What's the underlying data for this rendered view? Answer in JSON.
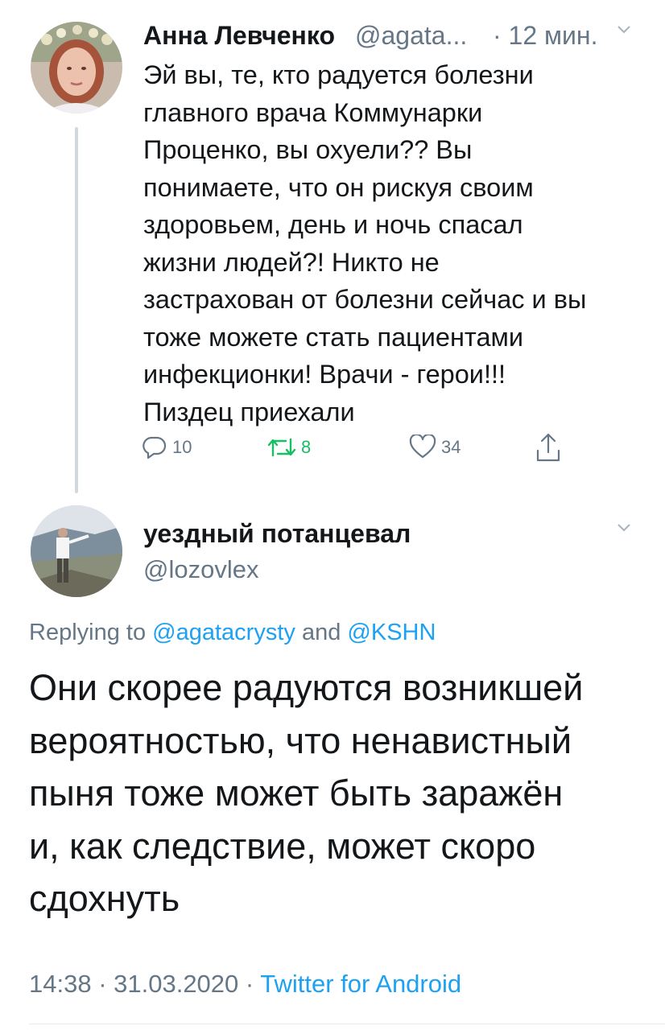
{
  "tweet1": {
    "author_name": "Анна Левченко",
    "handle": "@agata...",
    "time": "· 12 мин.",
    "body_lines": [
      "Эй вы, те, кто радуется болезни",
      "главного врача Коммунарки",
      "Проценко, вы охуели?? Вы",
      "понимаете, что он рискуя своим",
      "здоровьем, день и ночь спасал",
      "жизни людей?! Никто не",
      "застрахован от болезни сейчас и вы",
      "тоже можете стать пациентами",
      "инфекционки! Врачи - герои!!!",
      "Пиздец приехали"
    ],
    "replies": "10",
    "retweets": "8",
    "likes": "34"
  },
  "tweet2": {
    "author_name": "уездный потанцевал",
    "handle": "@lozovlex",
    "replying_prefix": "Replying to",
    "mention1": "@agatacrysty",
    "and": "and",
    "mention2": "@KSHN",
    "body_lines": [
      "Они скорее радуются возникшей",
      "вероятностью, что ненавистный",
      "пыня тоже может быть заражён",
      "и, как следствие, может скоро",
      "сдохнуть"
    ],
    "timestamp": "14:38 · 31.03.2020 ·",
    "source": "Twitter for Android"
  },
  "icons": {
    "reply": "reply-icon",
    "retweet": "retweet-icon",
    "like": "heart-icon",
    "share": "share-icon",
    "menu": "chevron-down-icon"
  },
  "colors": {
    "text": "#14171a",
    "secondary": "#657786",
    "link": "#1da1f2",
    "retweet_green": "#17bf63",
    "thread_line": "#cfd9de"
  }
}
